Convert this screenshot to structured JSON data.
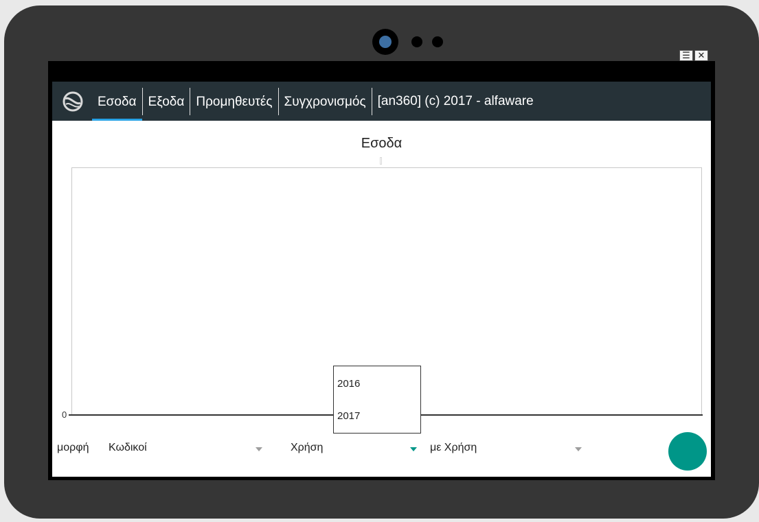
{
  "window_controls": {
    "menu": "☰",
    "close": "✕"
  },
  "nav": {
    "tabs": [
      {
        "label": "Εσοδα"
      },
      {
        "label": "Εξοδα"
      },
      {
        "label": "Προμηθευτές"
      },
      {
        "label": "Συγχρονισμός"
      }
    ],
    "active_tab": "Εσοδα",
    "title": "[an360] (c) 2017 - alfaware"
  },
  "chart": {
    "title": "Εσοδα",
    "y_tick": "0"
  },
  "chart_data": {
    "type": "bar",
    "title": "Εσοδα",
    "categories": [],
    "values": [],
    "y_ticks": [
      "0"
    ],
    "grid": false
  },
  "dropdown_popup": {
    "options": [
      "2016",
      "2017"
    ]
  },
  "form": {
    "format_label": "μορφή",
    "format_value": "Κωδικοί",
    "year_value": "Χρήση",
    "compare_value": "με Χρήση"
  },
  "colors": {
    "navbar": "#263238",
    "accent": "#29a3e6",
    "fab": "#009688"
  }
}
